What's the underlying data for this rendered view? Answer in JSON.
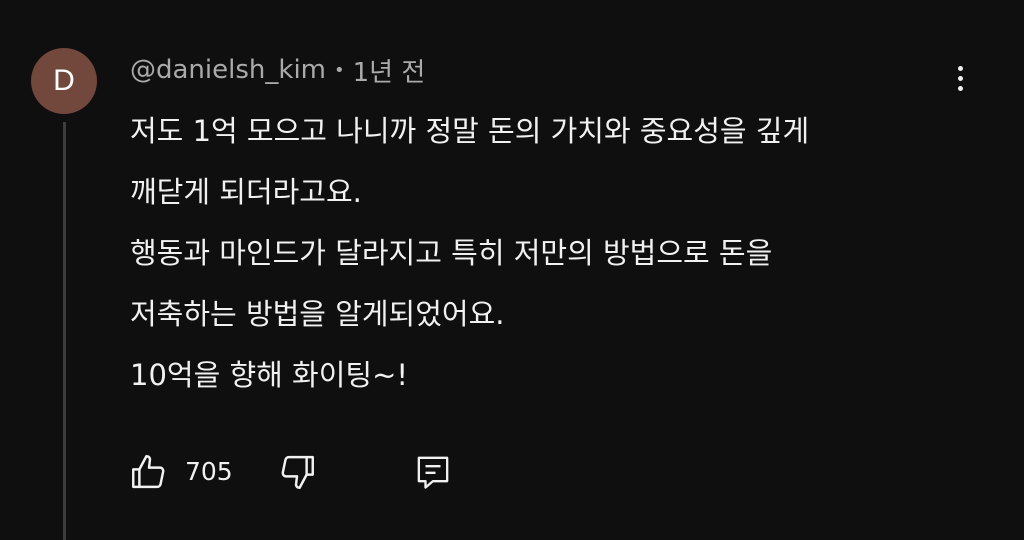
{
  "comment": {
    "avatar_letter": "D",
    "author": "@danielsh_kim",
    "separator": "•",
    "time": "1년 전",
    "lines": [
      "저도 1억 모으고 나니까 정말 돈의 가치와 중요성을 깊게",
      "깨닫게 되더라고요.",
      "행동과 마인드가 달라지고 특히 저만의 방법으로 돈을",
      "저축하는 방법을 알게되었어요.",
      "10억을 향해 화이팅~!"
    ],
    "like_count": "705"
  },
  "icons": {
    "more": "more-vertical-icon",
    "like": "thumb-up-icon",
    "dislike": "thumb-down-icon",
    "reply": "reply-comment-icon"
  },
  "colors": {
    "background": "#0f0f0f",
    "avatar": "#71483b",
    "text": "#f1f1f1",
    "meta_text": "#aaaaaa",
    "thread_line": "#3d3d3d"
  }
}
